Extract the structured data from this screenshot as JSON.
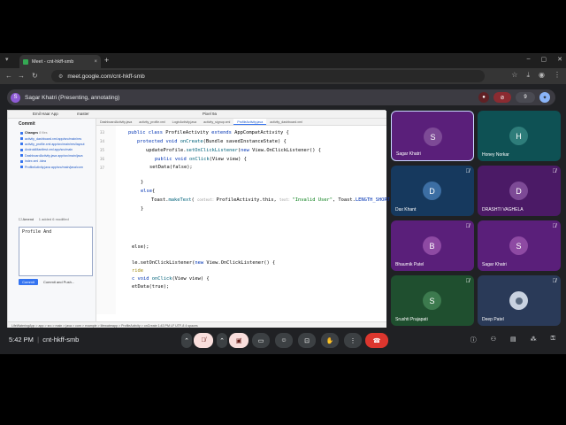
{
  "browser": {
    "tab_title": "Meet - cnt-hkff-smb",
    "tab_close": "×",
    "new_tab": "+",
    "url": "meet.google.com/cnt-hkff-smb"
  },
  "presenter": {
    "initial": "S",
    "text": "Sagar Khatri (Presenting, annotating)",
    "count": "9"
  },
  "ide": {
    "project": "Emil Haar App",
    "branch": "master",
    "run_config": "Pixel 9a",
    "commit_title": "Commit",
    "changes_header": "Changes",
    "changes_count": "8 files",
    "changed_files": [
      "activity_dashboard.xml app/src/main/res",
      "activity_profile.xml app/src/main/res/layout",
      "AndroidManifest.xml app/src/main",
      "DashboardActivity.java app/src/main/java",
      "index.xml .idea",
      "ProfileActivity.java app/src/main/java/com"
    ],
    "amend_label": "Amend",
    "added_modified": "1 added  6 modified",
    "commit_message": "Profile And",
    "commit_button": "Commit",
    "commit_push_button": "Commit and Push...",
    "editor_tabs": [
      "DashboardActivity.java",
      "activity_profile.xml",
      "LoginActivity.java",
      "activity_signup.xml",
      "ProfileActivity.java",
      "activity_dashboard.xml"
    ],
    "line_numbers": [
      "33",
      "34",
      "35",
      "36",
      "37"
    ],
    "status_text": "LifeWateringApp > app > src > main > java > com > example > lifewaterapp > ProfileActivity > onCreate    1:43 PM   LF   UTF-8   4 spaces",
    "code": {
      "l1a": "public class ",
      "l1b": "ProfileActivity ",
      "l1c": "extends ",
      "l1d": "AppCompatActivity {",
      "l2a": "protected void ",
      "l2b": "onCreate",
      "l2c": "(Bundle savedInstanceState) {",
      "l3a": "updateProfile.",
      "l3b": "setOnClickListener",
      "l3c": "(",
      "l3d": "new ",
      "l3e": "View.OnClickListener() {",
      "l4a": "public void ",
      "l4b": "onClick",
      "l4c": "(View view) {",
      "l5": "setData(false);",
      "l6": "}",
      "l7a": "else",
      "l7b": "{",
      "l8a": "Toast.",
      "l8b": "makeText",
      "l8c": "( ",
      "l8d": "context: ",
      "l8e": "ProfileActivity.this, ",
      "l8f": "text: ",
      "l8g": "\"Invalid User\"",
      "l8h": ", Toast.",
      "l8i": "LENGTH_SHORT",
      "l8j": ")",
      "l9": "}",
      "l10": "else);",
      "l11a": "le.setOnClickListener(",
      "l11b": "new ",
      "l11c": "View.OnClickListener() {",
      "l12": "ride",
      "l13a": "c void ",
      "l13b": "onClick",
      "l13c": "(View view) {",
      "l14": "etData(true);"
    }
  },
  "participants": [
    {
      "name": "Sagar Khatri",
      "initial": "S",
      "muted": false
    },
    {
      "name": "Honey Norkar",
      "initial": "H",
      "muted": false
    },
    {
      "name": "Dax Khant",
      "initial": "D",
      "muted": true
    },
    {
      "name": "DRASHTI VAGHELA",
      "initial": "D",
      "muted": true
    },
    {
      "name": "Bhaumik Patel",
      "initial": "B",
      "muted": true
    },
    {
      "name": "Sagar Khatri",
      "initial": "S",
      "muted": true
    },
    {
      "name": "Srushti Prajapati",
      "initial": "S",
      "muted": true
    },
    {
      "name": "Deep Patel",
      "initial": "",
      "muted": true
    }
  ],
  "meeting": {
    "time": "5:42 PM",
    "separator": "|",
    "code": "cnt-hkff-smb"
  },
  "colors": {
    "meet_bg": "#202124",
    "tile_purple": "#5a1f7a",
    "tile_blue": "#16395e",
    "tile_green": "#1f4f2f",
    "tile_teal": "#0e5154",
    "end_call": "#dc362e",
    "muted_ctrl": "#f9dedc"
  }
}
